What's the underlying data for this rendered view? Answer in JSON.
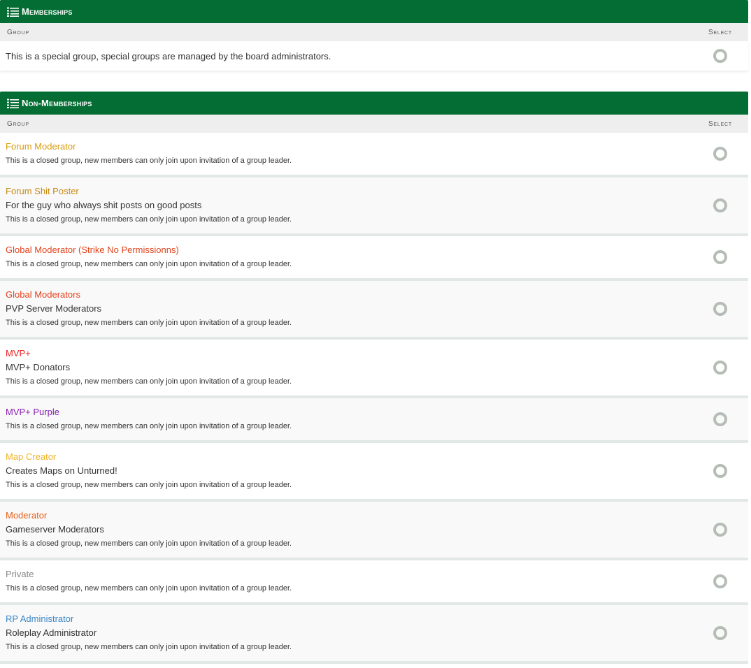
{
  "colors": {
    "header_bg": "#036d33",
    "header_text": "#ffffff",
    "colhead_bg": "#eeeeee",
    "row_divider": "#e1e8e6",
    "radio_outline": "#b6bdb6"
  },
  "icons": {
    "header_icon": "list-icon",
    "select_icon": "radio-button-icon"
  },
  "memberships": {
    "title": "Memberships",
    "col_group": "Group",
    "col_select": "Select",
    "rows": [
      {
        "text": "This is a special group, special groups are managed by the board administrators."
      }
    ]
  },
  "non_memberships": {
    "title": "Non-Memberships",
    "col_group": "Group",
    "col_select": "Select",
    "rows": [
      {
        "name": "Forum Moderator",
        "name_color": "#d89c0e",
        "desc": "",
        "note": "This is a closed group, new members can only join upon invitation of a group leader."
      },
      {
        "name": "Forum Shit Poster",
        "name_color": "#c78a14",
        "desc": "For the guy who always shit posts on good posts",
        "note": "This is a closed group, new members can only join upon invitation of a group leader."
      },
      {
        "name": "Global Moderator (Strike No Permissionns)",
        "name_color": "#e2431b",
        "desc": "",
        "note": "This is a closed group, new members can only join upon invitation of a group leader."
      },
      {
        "name": "Global Moderators",
        "name_color": "#e8411c",
        "desc": "PVP Server Moderators",
        "note": "This is a closed group, new members can only join upon invitation of a group leader."
      },
      {
        "name": "MVP+",
        "name_color": "#e82222",
        "desc": "MVP+ Donators",
        "note": "This is a closed group, new members can only join upon invitation of a group leader."
      },
      {
        "name": "MVP+ Purple",
        "name_color": "#8a1fb0",
        "desc": "",
        "note": "This is a closed group, new members can only join upon invitation of a group leader."
      },
      {
        "name": "Map Creator",
        "name_color": "#f0b429",
        "desc": "Creates Maps on Unturned!",
        "note": "This is a closed group, new members can only join upon invitation of a group leader."
      },
      {
        "name": "Moderator",
        "name_color": "#e8611c",
        "desc": "Gameserver Moderators",
        "note": "This is a closed group, new members can only join upon invitation of a group leader."
      },
      {
        "name": "Private",
        "name_color": "#888888",
        "desc": "",
        "note": "This is a closed group, new members can only join upon invitation of a group leader."
      },
      {
        "name": "RP Administrator",
        "name_color": "#3d86c6",
        "desc": "Roleplay Administrator",
        "note": "This is a closed group, new members can only join upon invitation of a group leader."
      }
    ]
  }
}
